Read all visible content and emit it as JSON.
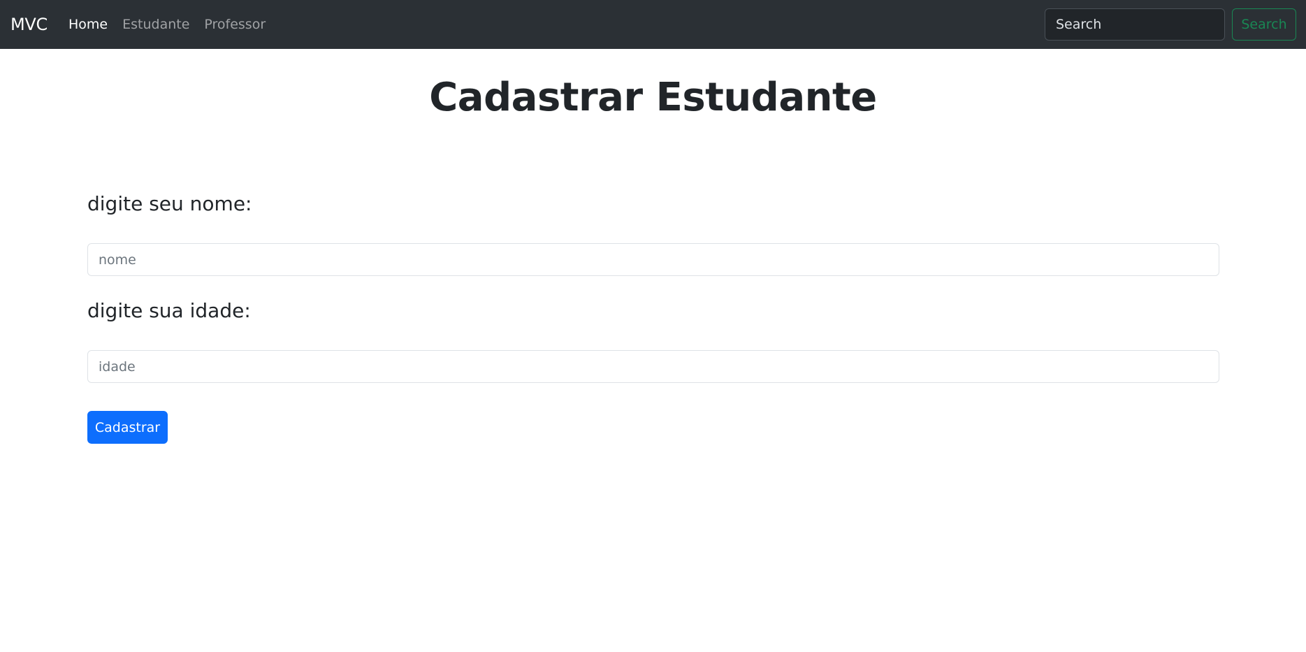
{
  "navbar": {
    "brand": "MVC",
    "links": [
      {
        "label": "Home",
        "active": true
      },
      {
        "label": "Estudante",
        "active": false
      },
      {
        "label": "Professor",
        "active": false
      }
    ],
    "search": {
      "placeholder": "Search",
      "button_label": "Search"
    }
  },
  "main": {
    "title": "Cadastrar Estudante",
    "fields": [
      {
        "label": "digite seu nome:",
        "placeholder": "nome"
      },
      {
        "label": "digite sua idade:",
        "placeholder": "idade"
      }
    ],
    "submit_label": "Cadastrar"
  },
  "colors": {
    "navbar_bg": "#2b3035",
    "primary": "#0d6efd",
    "success": "#198754",
    "text": "#212529"
  }
}
